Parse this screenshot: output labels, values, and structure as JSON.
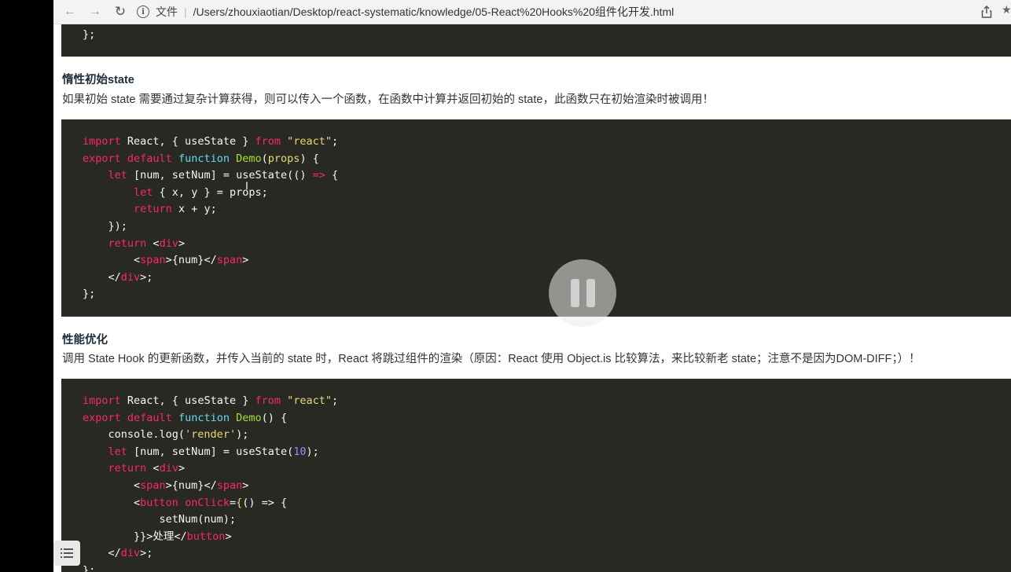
{
  "browser": {
    "file_label": "文件",
    "separator": "|",
    "url": "/Users/zhouxiaotian/Desktop/react-systematic/knowledge/05-React%20Hooks%20组件化开发.html"
  },
  "sections": [
    {
      "title": "惰性初始state",
      "text": "如果初始 state 需要通过复杂计算获得，则可以传入一个函数，在函数中计算并返回初始的 state，此函数只在初始渲染时被调用！"
    },
    {
      "title": "性能优化",
      "text": "调用 State Hook 的更新函数，并传入当前的 state 时，React 将跳过组件的渲染（原因：React 使用 Object.is 比较算法，来比较新老 state；注意不是因为DOM-DIFF；）！"
    }
  ],
  "icons": {
    "back": "arrow-left-icon",
    "forward": "arrow-right-icon",
    "reload": "reload-icon",
    "info": "info-icon",
    "share": "share-icon",
    "pause": "pause-icon",
    "toc": "list-icon"
  }
}
